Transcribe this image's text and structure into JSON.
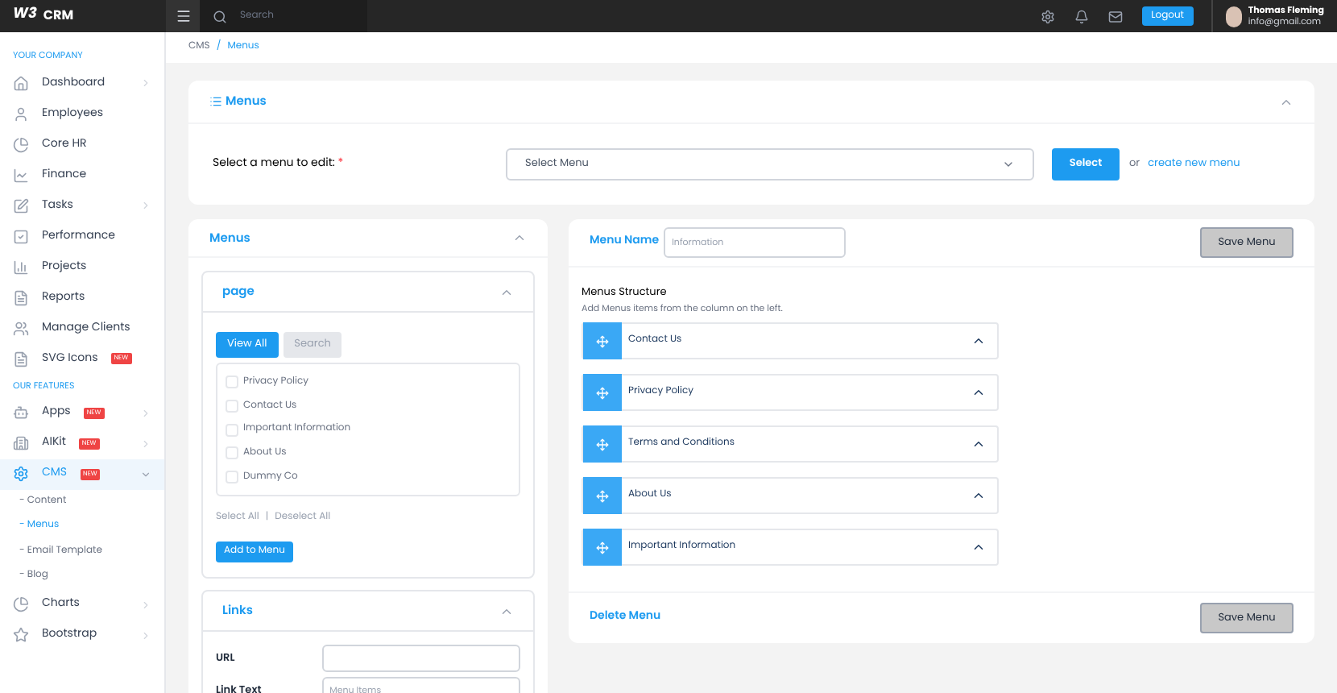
{
  "topbar": {
    "logo_mark": "W3",
    "logo_text": "CRM",
    "search": {
      "placeholder": "Search"
    },
    "logout": "Logout",
    "user": {
      "name": "Thomas Fleming",
      "email": "info@gmail.com"
    }
  },
  "sidebar": {
    "sections": [
      {
        "title": "YOUR COMPANY",
        "items": [
          {
            "label": "Dashboard",
            "arrow": true,
            "selected": false
          },
          {
            "label": "Employees",
            "arrow": false,
            "selected": false
          },
          {
            "label": "Core HR",
            "arrow": false,
            "selected": false
          },
          {
            "label": "Finance",
            "arrow": false,
            "selected": false
          },
          {
            "label": "Tasks",
            "arrow": true,
            "selected": false
          },
          {
            "label": "Performance",
            "arrow": false,
            "selected": false
          },
          {
            "label": "Projects",
            "arrow": false,
            "selected": false
          },
          {
            "label": "Reports",
            "arrow": false,
            "selected": false
          },
          {
            "label": "Manage Clients",
            "arrow": false,
            "selected": false
          },
          {
            "label": "SVG Icons",
            "arrow": false,
            "badge": "NEW",
            "selected": false
          }
        ]
      },
      {
        "title": "OUR FEATURES",
        "items": [
          {
            "label": "Apps",
            "arrow": true,
            "badge": "NEW",
            "selected": false
          },
          {
            "label": "AIKit",
            "arrow": true,
            "badge": "NEW",
            "selected": false
          },
          {
            "label": "CMS",
            "arrow": true,
            "badge": "NEW",
            "selected": true,
            "expanded": true,
            "children": [
              {
                "label": "- Content",
                "selected": false
              },
              {
                "label": "- Menus",
                "selected": true
              },
              {
                "label": "- Email Template",
                "selected": false
              },
              {
                "label": "- Blog",
                "selected": false
              }
            ]
          },
          {
            "label": "Charts",
            "arrow": true,
            "selected": false
          },
          {
            "label": "Bootstrap",
            "arrow": true,
            "selected": false
          }
        ]
      }
    ]
  },
  "breadcrumb": {
    "separator": "/",
    "items": [
      {
        "label": "CMS",
        "selected": false
      },
      {
        "label": "Menus",
        "selected": true
      }
    ]
  },
  "select_card": {
    "title": "Menus",
    "label": "Select a menu to edit:",
    "required_mark": "*",
    "dropdown": "Select Menu",
    "button": "Select",
    "or": "or",
    "link": "create new menu"
  },
  "left_panel": {
    "title": "Menus",
    "page_box": {
      "title": "page",
      "tabs": [
        {
          "label": "View All",
          "selected": true
        },
        {
          "label": "Search",
          "selected": false
        }
      ],
      "items": [
        {
          "label": "Privacy Policy",
          "checked": false
        },
        {
          "label": "Contact Us",
          "checked": false
        },
        {
          "label": "Important Information",
          "checked": false
        },
        {
          "label": "About Us",
          "checked": false
        },
        {
          "label": "Dummy Co",
          "checked": false
        }
      ],
      "select_all": "Select All",
      "separator": "|",
      "deselect_all": "Deselect All",
      "add_button": "Add to Menu"
    },
    "links_box": {
      "title": "Links",
      "fields": [
        {
          "label": "URL"
        },
        {
          "label": "Link Text",
          "placeholder": "Menu Items"
        }
      ]
    }
  },
  "right_panel": {
    "menu_name_label": "Menu Name",
    "menu_name_placeholder": "Information",
    "save_button": "Save Menu",
    "structure_title": "Menus Structure",
    "structure_hint": "Add Menus items from the column on the left.",
    "items": [
      {
        "label": "Contact Us",
        "expanded": true
      },
      {
        "label": "Privacy Policy",
        "expanded": true
      },
      {
        "label": "Terms and Conditions",
        "expanded": true
      },
      {
        "label": "About Us",
        "expanded": true
      },
      {
        "label": "Important Information",
        "expanded": true
      }
    ],
    "delete_link": "Delete Menu",
    "save_button_bottom": "Save Menu"
  }
}
